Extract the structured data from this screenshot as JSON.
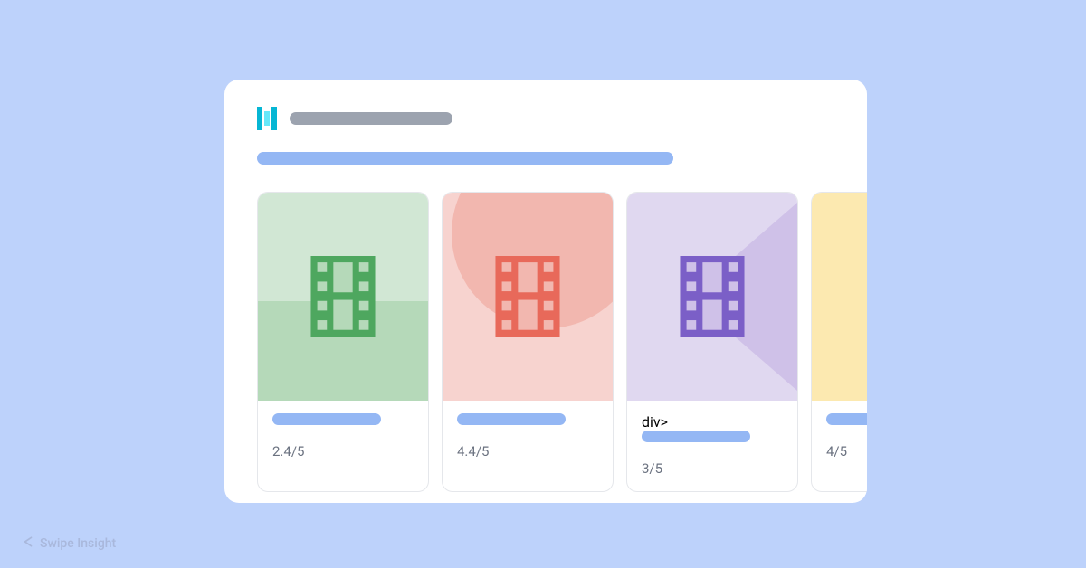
{
  "watermark": {
    "text": "Swipe Insight",
    "icon": "swipe-icon"
  },
  "logo": {
    "name": "brand-logo"
  },
  "header": {
    "title_placeholder": "",
    "subtitle_placeholder": ""
  },
  "cards": [
    {
      "color": "green",
      "icon": "film-icon",
      "title_placeholder": "",
      "rating": "2.4/5"
    },
    {
      "color": "red",
      "icon": "film-icon",
      "title_placeholder": "",
      "rating": "4.4/5"
    },
    {
      "color": "purple",
      "icon": "film-icon",
      "title_placeholder": "",
      "rating": "3/5"
    },
    {
      "color": "yellow",
      "icon": "film-icon",
      "title_placeholder": "",
      "rating": "4/5"
    }
  ]
}
